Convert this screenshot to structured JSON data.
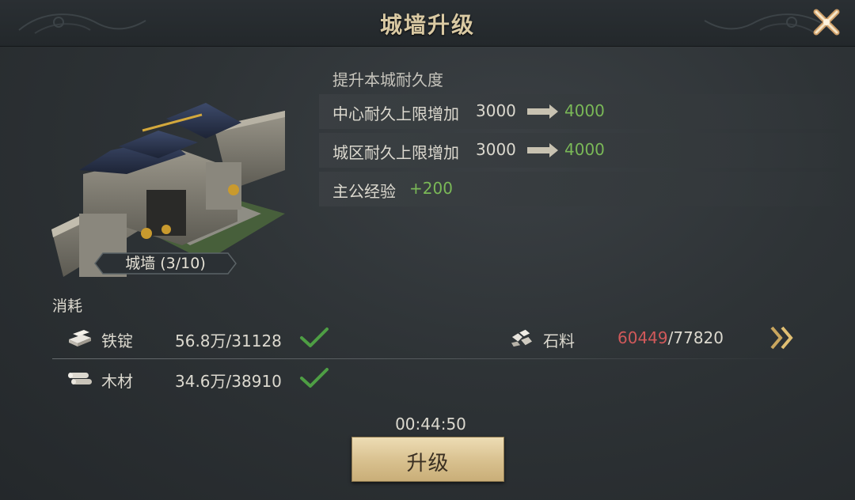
{
  "header": {
    "title": "城墙升级"
  },
  "building": {
    "name_level": "城墙 (3/10)"
  },
  "upgrade_info": {
    "subtitle": "提升本城耐久度",
    "stats": [
      {
        "label": "中心耐久上限增加",
        "from": "3000",
        "to": "4000"
      },
      {
        "label": "城区耐久上限增加",
        "from": "3000",
        "to": "4000"
      }
    ],
    "exp": {
      "label": "主公经验",
      "value": "+200"
    }
  },
  "consume": {
    "label": "消耗",
    "resources": [
      {
        "icon": "iron-ingot-icon",
        "name": "铁锭",
        "owned": "56.8万",
        "sep": "/",
        "required": "31128",
        "sufficient": true
      },
      {
        "icon": "stone-icon",
        "name": "石料",
        "owned": "60449",
        "sep": "/",
        "required": "77820",
        "sufficient": false
      },
      {
        "icon": "wood-icon",
        "name": "木材",
        "owned": "34.6万",
        "sep": "/",
        "required": "38910",
        "sufficient": true
      }
    ]
  },
  "timer": "00:44:50",
  "upgrade_button": {
    "label": "升级"
  },
  "colors": {
    "accent_gold": "#d9c9a3",
    "increase_green": "#7ab857",
    "shortage_red": "#d0595a",
    "check_green": "#4e9e44"
  }
}
